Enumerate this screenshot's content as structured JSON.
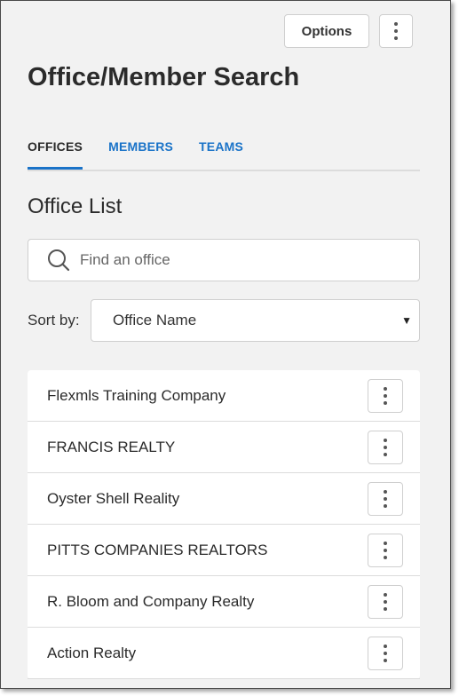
{
  "header": {
    "options_label": "Options",
    "more_icon": "kebab-vertical-icon"
  },
  "page": {
    "title": "Office/Member Search"
  },
  "tabs": [
    {
      "label": "OFFICES",
      "active": true
    },
    {
      "label": "MEMBERS",
      "active": false
    },
    {
      "label": "TEAMS",
      "active": false
    }
  ],
  "office_list": {
    "title": "Office List",
    "search": {
      "placeholder": "Find an office",
      "value": "",
      "icon": "search-icon"
    },
    "sort": {
      "label": "Sort by:",
      "selected": "Office Name"
    },
    "items": [
      {
        "name": "Flexmls Training Company"
      },
      {
        "name": "FRANCIS REALTY"
      },
      {
        "name": "Oyster Shell Reality"
      },
      {
        "name": "PITTS COMPANIES REALTORS"
      },
      {
        "name": "R. Bloom and Company Realty"
      },
      {
        "name": "Action Realty"
      }
    ]
  },
  "colors": {
    "accent": "#1a73c8",
    "background": "#f2f2f2",
    "text": "#2b2b2b"
  }
}
